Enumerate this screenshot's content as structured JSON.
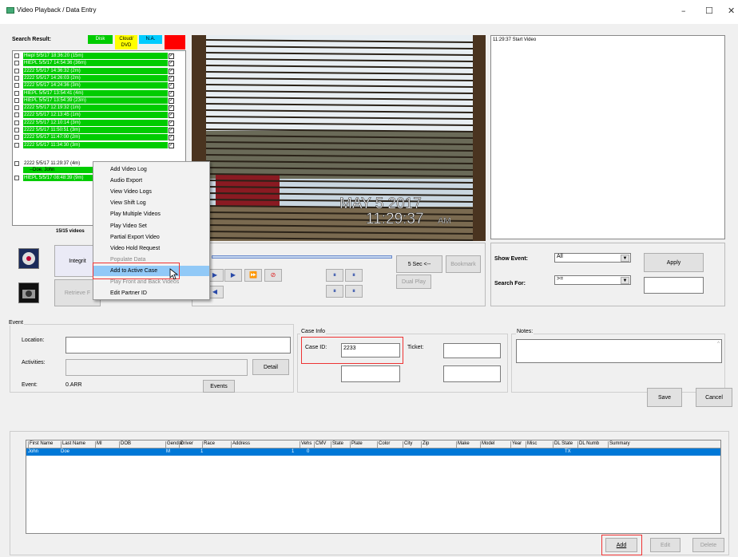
{
  "window": {
    "title": "Video Playback / Data Entry",
    "minimize": "–",
    "maximize": "☐",
    "close": "✕"
  },
  "search": {
    "label": "Search Result:",
    "legend": [
      {
        "label": "Disk",
        "color": "#00cc00"
      },
      {
        "label": "Cloud/ DVD",
        "color": "#ffff00"
      },
      {
        "label": "N.A.",
        "color": "#00ccff"
      },
      {
        "label": "",
        "color": "#ff0000"
      }
    ],
    "rows": [
      "Hiepl 5/5/17 18:36:20 (15m)",
      "HIEPL 5/5/17 14:54:36 (36m)",
      "2222 5/5/17 14:36:32 (2m)",
      "2222 5/5/17 14:26:03 (2m)",
      "2222 5/5/17 14:24:36 (3m)",
      "HIEPL 5/5/17 13:54:41 (4m)",
      "HIEPL 5/5/17 13:54:39 (23m)",
      "2222 5/5/17 12:19:32 (1m)",
      "2222 5/5/17 12:13:45 (1m)",
      "2222 5/5/17 12:10:14 (3m)",
      "2222 5/5/17 11:50:51 (3m)",
      "2222 5/5/17 11:47:00 (2m)",
      "2222 5/5/17 11:34:30 (3m)"
    ],
    "selected_row": "2222 5/5/17 11:29:37 (4m)",
    "sub_row": "--Doe, John",
    "last_row": "HIEPL 5/5/17 08:48:39 (9m)",
    "count": "15/15 videos"
  },
  "context_menu": {
    "items": [
      {
        "label": "Add Video Log",
        "disabled": false
      },
      {
        "label": "Audio Export",
        "disabled": false
      },
      {
        "label": "View Video Logs",
        "disabled": false
      },
      {
        "label": "View Shift Log",
        "disabled": false
      },
      {
        "label": "Play Multiple Videos",
        "disabled": false
      },
      {
        "label": "Play Video Set",
        "disabled": false
      },
      {
        "label": "Partial Export Video",
        "disabled": false
      },
      {
        "label": "Video Hold Request",
        "disabled": false
      },
      {
        "label": "Populate Data",
        "disabled": true
      },
      {
        "label": "Add to Active Case",
        "disabled": false,
        "highlighted": true
      },
      {
        "label": "Play Front and Back Videos",
        "disabled": true
      },
      {
        "label": "Edit Partner ID",
        "disabled": false
      }
    ]
  },
  "video": {
    "date": "MAY  5 2017",
    "time": "11:29:37",
    "ampm": "AM"
  },
  "left_panel": {
    "integrity": "Integrit",
    "retrieve": "Retrieve F"
  },
  "playback": {
    "five_sec": "5 Sec <--",
    "bookmark": "Bookmark",
    "dual_play": "Dual Play"
  },
  "log": {
    "entry": "11:29:37 Start Video"
  },
  "filter": {
    "show_event_label": "Show Event:",
    "show_event_value": "All",
    "search_for_label": "Search For:",
    "search_for_value": ">=",
    "apply": "Apply"
  },
  "event": {
    "group": "Event",
    "location_label": "Location:",
    "activities_label": "Activities:",
    "detail": "Detail",
    "event_label": "Event:",
    "event_value": "0.ARR",
    "events_button": "Events"
  },
  "case_info": {
    "group": "Case Info",
    "case_id_label": "Case ID:",
    "case_id_value": "2233",
    "ticket_label": "Ticket:"
  },
  "notes": {
    "label": "Notes:",
    "save": "Save",
    "cancel": "Cancel"
  },
  "people": {
    "columns": [
      "First Name",
      "Last Name",
      "MI",
      "DOB",
      "Gender",
      "Driver",
      "Race",
      "Address",
      "Vehs",
      "CMV",
      "State",
      "Plate",
      "Color",
      "City",
      "Zip",
      "Make",
      "Model",
      "Year",
      "Misc",
      "DL State",
      "DL Numb",
      "Summary"
    ],
    "rows": [
      {
        "first": "John",
        "last": "Doe",
        "gender": "M",
        "driver": "1",
        "vehs": "1",
        "cmv": "0",
        "dl_state": "TX"
      }
    ],
    "add": "Add",
    "edit": "Edit",
    "delete": "Delete"
  }
}
